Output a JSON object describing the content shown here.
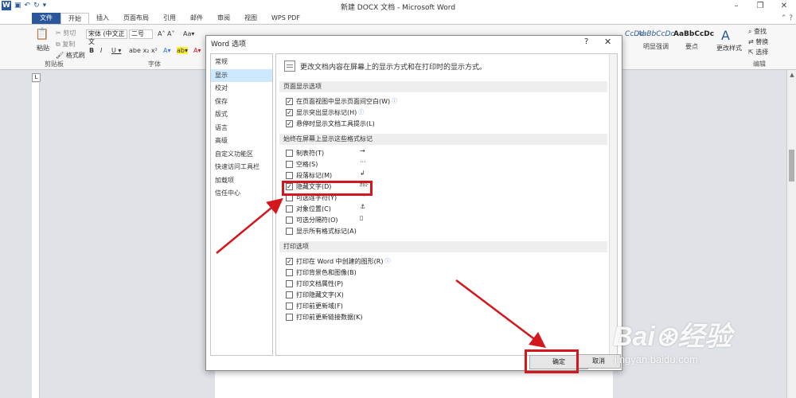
{
  "window": {
    "title": "新建 DOCX 文档 - Microsoft Word",
    "controls": [
      "–",
      "❐",
      "✕"
    ]
  },
  "ribbon_tabs": [
    "文件",
    "开始",
    "插入",
    "页面布局",
    "引用",
    "邮件",
    "审阅",
    "视图",
    "WPS PDF"
  ],
  "ribbon": {
    "paste": "粘贴",
    "cut": "剪切",
    "copy": "复制",
    "format_painter": "格式刷",
    "clipboard_group": "剪贴板",
    "font_name": "宋体 (中文正文",
    "font_size": "二号",
    "font_group": "字体",
    "style_cdd": "CcDd",
    "style_emphasis_sample": "AaBbCcDc",
    "style_emphasis": "明显强调",
    "style_key_sample": "AaBbCcDc",
    "style_key": "要点",
    "change_styles": "更改样式",
    "find": "查找",
    "replace": "替换",
    "select": "选择",
    "edit_group": "编辑"
  },
  "dialog": {
    "title": "Word 选项",
    "help": "?",
    "close": "✕",
    "nav": [
      "常规",
      "显示",
      "校对",
      "保存",
      "版式",
      "语言",
      "高级",
      "自定义功能区",
      "快速访问工具栏",
      "加载项",
      "信任中心"
    ],
    "selected_nav": "显示",
    "header": "更改文档内容在屏幕上的显示方式和在打印时的显示方式。",
    "sections": {
      "page_display": "页面显示选项",
      "format_marks": "始终在屏幕上显示这些格式标记",
      "print": "打印选项"
    },
    "page_display_options": [
      {
        "label": "在页面视图中显示页面间空白(W)",
        "checked": true
      },
      {
        "label": "显示突出显示标记(H)",
        "checked": true
      },
      {
        "label": "悬停时显示文档工具提示(L)",
        "checked": true
      }
    ],
    "format_mark_options": [
      {
        "label": "制表符(T)",
        "symbol": "→",
        "checked": false
      },
      {
        "label": "空格(S)",
        "symbol": "···",
        "checked": false
      },
      {
        "label": "段落标记(M)",
        "symbol": "↲",
        "checked": false
      },
      {
        "label": "隐藏文字(D)",
        "symbol": "abc",
        "checked": true
      },
      {
        "label": "可选连字符(Y)",
        "symbol": "¬",
        "checked": false
      },
      {
        "label": "对象位置(C)",
        "symbol": "⚓",
        "checked": false
      },
      {
        "label": "可选分隔符(O)",
        "symbol": "▯",
        "checked": false
      },
      {
        "label": "显示所有格式标记(A)",
        "symbol": "",
        "checked": false
      }
    ],
    "print_options": [
      {
        "label": "打印在 Word 中创建的图形(R)",
        "checked": true
      },
      {
        "label": "打印背景色和图像(B)",
        "checked": false
      },
      {
        "label": "打印文档属性(P)",
        "checked": false
      },
      {
        "label": "打印隐藏文字(X)",
        "checked": false
      },
      {
        "label": "打印前更新域(F)",
        "checked": false
      },
      {
        "label": "打印前更新链接数据(K)",
        "checked": false
      }
    ],
    "ok": "确定",
    "cancel": "取消"
  },
  "watermark": {
    "logo": "Bai⊛经验",
    "url": "jingyan.baidu.com"
  },
  "colors": {
    "accent": "#2b579a",
    "annotation": "#d4161d",
    "nav_selected": "#cde8ff"
  }
}
